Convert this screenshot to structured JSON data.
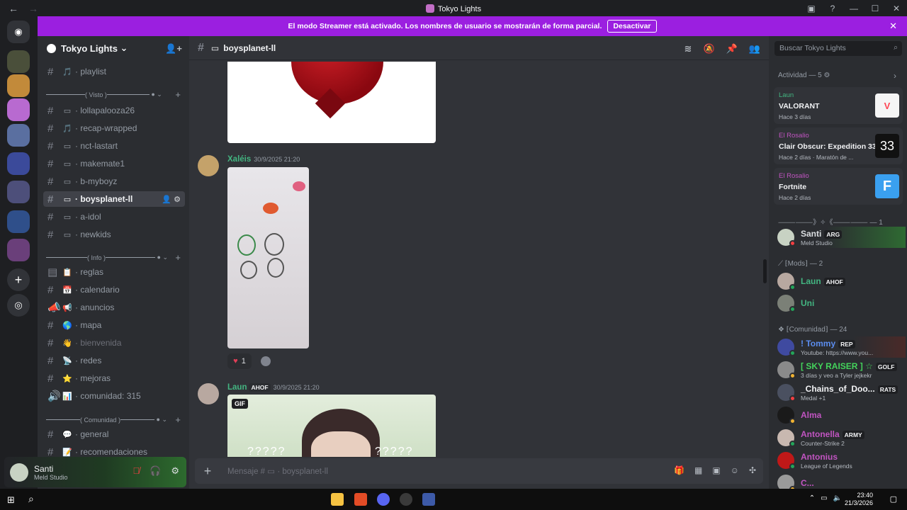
{
  "window": {
    "title": "Tokyo Lights"
  },
  "banner": {
    "text": "El modo Streamer está activado. Los nombres de usuario se mostrarán de forma parcial.",
    "button": "Desactivar"
  },
  "guild": {
    "name": "Tokyo Lights"
  },
  "categories": {
    "visto": "( Visto )",
    "info": "( Info )",
    "comunidad": "( Comunidad )"
  },
  "channels": [
    {
      "label": "· playlist",
      "icon": "🎵"
    },
    {
      "label": "· lollapalooza26",
      "icon": "▭"
    },
    {
      "label": "· recap-wrapped",
      "icon": "🎵"
    },
    {
      "label": "· nct-lastart",
      "icon": "▭"
    },
    {
      "label": "· makemate1",
      "icon": "▭"
    },
    {
      "label": "· b-myboyz",
      "icon": "▭"
    },
    {
      "label": "· boysplanet-ll",
      "icon": "▭"
    },
    {
      "label": "· a-idol",
      "icon": "▭"
    },
    {
      "label": "· newkids",
      "icon": "▭"
    },
    {
      "label": "· reglas",
      "icon": "📋"
    },
    {
      "label": "· calendario",
      "icon": "📅"
    },
    {
      "label": "· anuncios",
      "icon": "📢"
    },
    {
      "label": "· mapa",
      "icon": "🌎"
    },
    {
      "label": "· bienvenida",
      "icon": "👋"
    },
    {
      "label": "· redes",
      "icon": "📡"
    },
    {
      "label": "· mejoras",
      "icon": "⭐"
    },
    {
      "label": "· comunidad: 315",
      "icon": "📊"
    },
    {
      "label": "· general",
      "icon": "💬"
    },
    {
      "label": "· recomendaciones",
      "icon": "📝"
    }
  ],
  "user": {
    "name": "Santi",
    "status": "Meld Studio"
  },
  "chat": {
    "channel": "boysplanet-ll",
    "messages": [
      {
        "author": "Xaléis",
        "timestamp": "30/9/2025 21:20",
        "reaction_count": "1"
      },
      {
        "author": "Laun",
        "tag": "AHOF",
        "timestamp": "30/9/2025 21:20",
        "gif_badge": "GIF",
        "question_marks": "?????"
      }
    ],
    "composer_placeholder": "Mensaje # ▭ · boysplanet-ll"
  },
  "members": {
    "search_placeholder": "Buscar Tokyo Lights",
    "activity_header": "Actividad — 5",
    "activities": [
      {
        "user": "Laun",
        "game": "VALORANT",
        "time": "Hace 3 días"
      },
      {
        "user": "El Rosalio",
        "game": "Clair Obscur: Expedition 33",
        "time": "Hace 2 días · Maratón de ..."
      },
      {
        "user": "El Rosalio",
        "game": "Fortnite",
        "time": "Hace 2 días"
      }
    ],
    "section_top": "⸻⸻》✧《⸻⸻ — 1",
    "section_mods": "⟋ ⁅Mods⁆ — 2",
    "section_comunidad": "❖ ⁅Comunidad⁆ — 24",
    "list": [
      {
        "name": "Santi",
        "tag": "ARG",
        "sub": "Meld Studio",
        "color": "#dbdee1"
      },
      {
        "name": "Laun",
        "tag": "AHOF",
        "sub": "",
        "color": "#43b581"
      },
      {
        "name": "Uni",
        "tag": "",
        "sub": "",
        "color": "#43b581"
      },
      {
        "name": "! Tommy",
        "tag": "REP",
        "sub": "Youtube: https://www.you...",
        "color": "#5b8def"
      },
      {
        "name": "[ SKY RAISER ] ☆",
        "tag": "GOLF",
        "sub": "3 días y veo a Tyler jejkekr",
        "color": "#43d35b"
      },
      {
        "name": "_Chains_of_Doo...",
        "tag": "RATS",
        "sub": "Medal +1",
        "color": "#f2f3f5"
      },
      {
        "name": "Alma",
        "tag": "",
        "sub": "",
        "color": "#c154c1"
      },
      {
        "name": "Antonella",
        "tag": "ARMY",
        "sub": "Counter-Strike 2",
        "color": "#c154c1"
      },
      {
        "name": "Antonius",
        "tag": "",
        "sub": "League of Legends",
        "color": "#c154c1"
      },
      {
        "name": "C...",
        "tag": "",
        "sub": "",
        "color": "#c154c1"
      }
    ]
  },
  "taskbar": {
    "time": "23:40",
    "date": "21/3/2026"
  }
}
